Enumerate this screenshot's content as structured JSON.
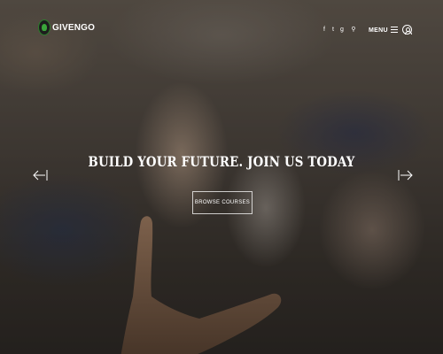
{
  "brand": {
    "name": "GIVENGO",
    "logo_icon": "tree-globe-icon"
  },
  "header": {
    "social": [
      {
        "icon": "facebook-icon",
        "glyph": "f"
      },
      {
        "icon": "twitter-icon",
        "glyph": "t"
      },
      {
        "icon": "googleplus-icon",
        "glyph": "g"
      },
      {
        "icon": "search-icon",
        "glyph": "⚲"
      }
    ],
    "menu_label": "MENU",
    "menu_icon": "hamburger-icon",
    "user_icon": "user-icon"
  },
  "slide": {
    "headline": "BUILD YOUR FUTURE. JOIN US TODAY",
    "cta_label": "BROWSE COURSES",
    "prev_icon": "arrow-left-icon",
    "next_icon": "arrow-right-icon"
  },
  "colors": {
    "text": "#ffffff",
    "logo_green": "#3aa63a"
  }
}
